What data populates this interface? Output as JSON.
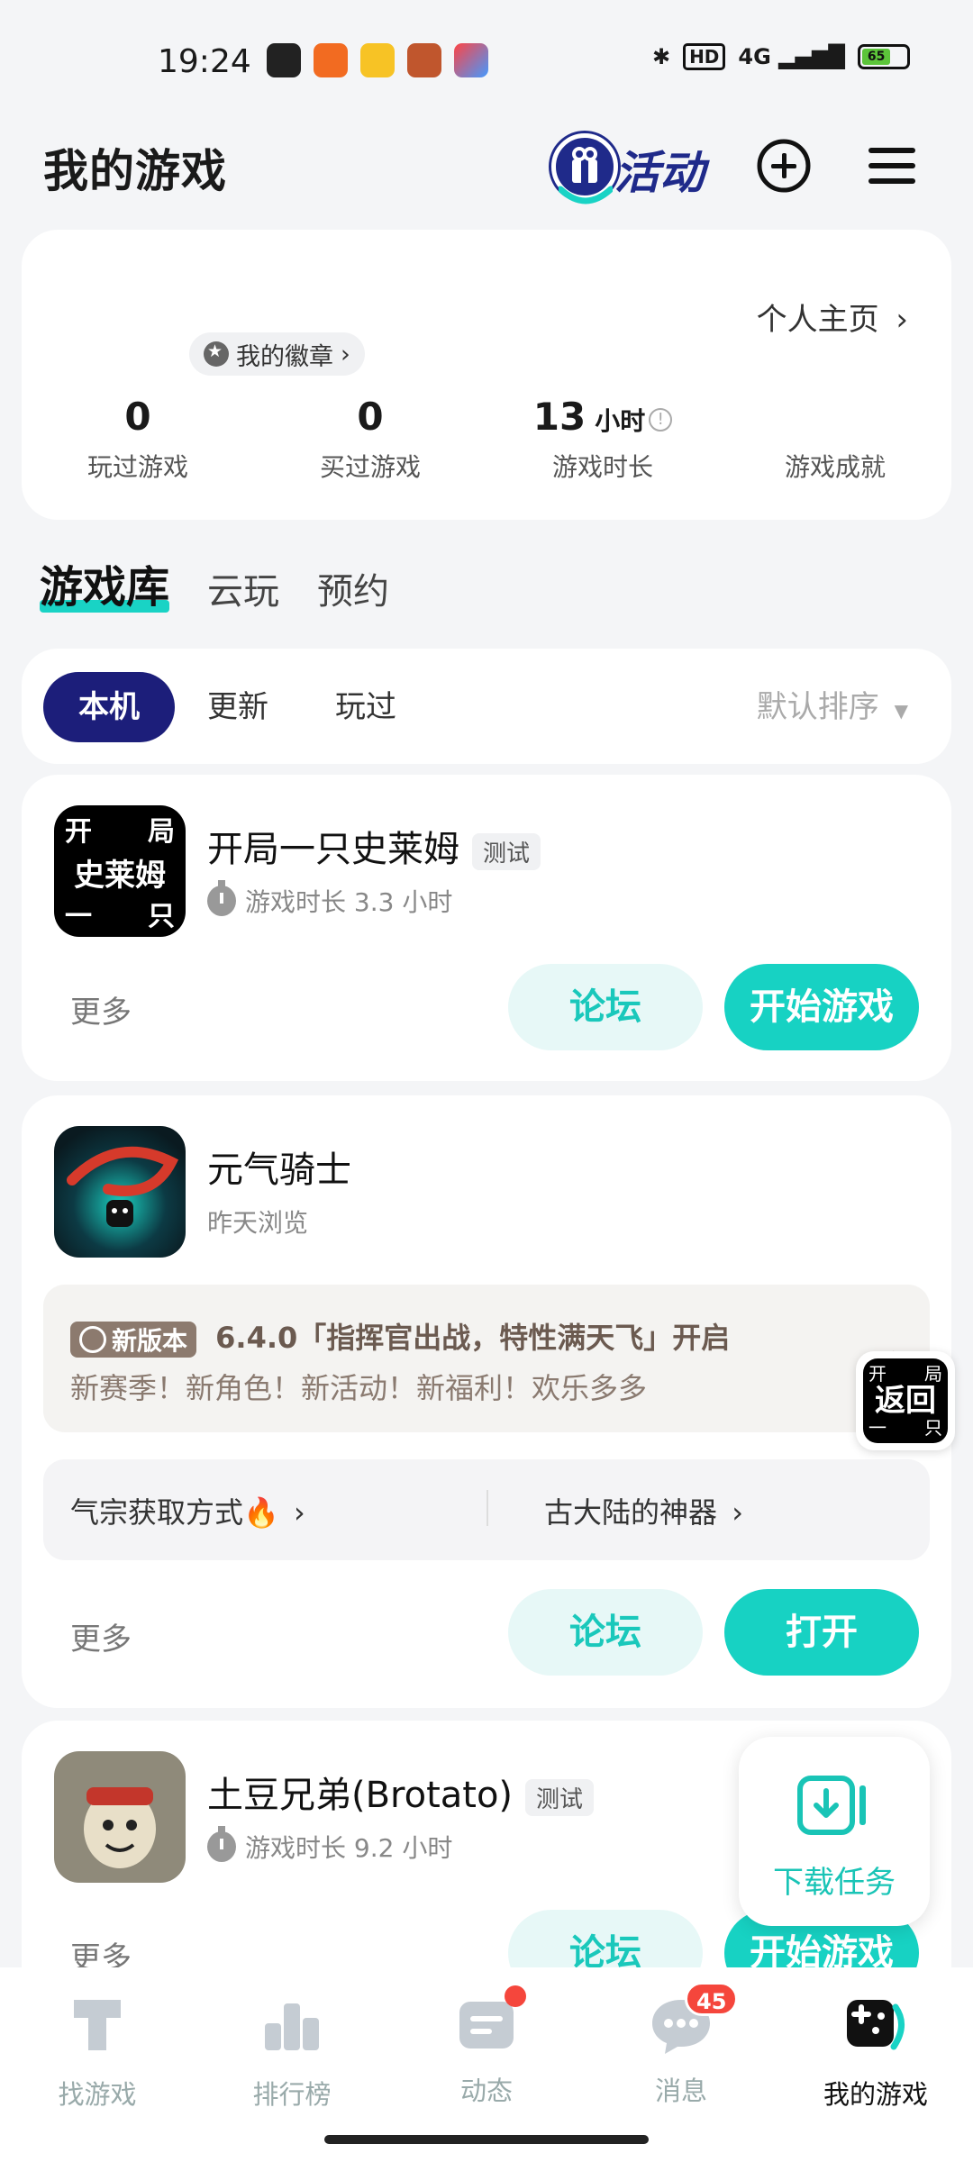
{
  "status_bar": {
    "time": "19:24",
    "hd": "HD",
    "network": "4G",
    "battery": "65"
  },
  "header": {
    "title": "我的游戏",
    "activity_label": "活动"
  },
  "profile": {
    "homepage_link": "个人主页",
    "badge_label": "我的徽章",
    "stats": [
      {
        "value": "0",
        "unit": "",
        "label": "玩过游戏"
      },
      {
        "value": "0",
        "unit": "",
        "label": "买过游戏"
      },
      {
        "value": "13",
        "unit": "小时",
        "label": "游戏时长"
      },
      {
        "value": "",
        "unit": "",
        "label": "游戏成就"
      }
    ]
  },
  "main_tabs": [
    "游戏库",
    "云玩",
    "预约"
  ],
  "filter": {
    "chips": [
      "本机",
      "更新",
      "玩过"
    ],
    "sort_label": "默认排序"
  },
  "games": [
    {
      "icon_text": [
        "开",
        "局",
        "史莱姆",
        "一",
        "只"
      ],
      "name": "开局一只史莱姆",
      "tag": "测试",
      "playtime": "游戏时长 3.3 小时",
      "more": "更多",
      "forum": "论坛",
      "action": "开始游戏"
    },
    {
      "name": "元气骑士",
      "subtitle": "昨天浏览",
      "update_tag": "新版本",
      "update_title": "6.4.0「指挥官出战，特性满天飞」开启",
      "update_desc": "新赛季！新角色！新活动！新福利！欢乐多多",
      "link_left": "气宗获取方式🔥",
      "link_right": "古大陆的神器",
      "more": "更多",
      "forum": "论坛",
      "action": "打开"
    },
    {
      "name": "土豆兄弟(Brotato)",
      "tag": "测试",
      "playtime": "游戏时长 9.2 小时",
      "more": "更多",
      "forum": "论坛",
      "action": "开始游戏"
    }
  ],
  "float_return": {
    "label": "返回",
    "corner_text": [
      "开",
      "局",
      "一",
      "只"
    ]
  },
  "download_task": {
    "label": "下载任务"
  },
  "bottom_nav": [
    {
      "label": "找游戏",
      "icon": "find-game-icon"
    },
    {
      "label": "排行榜",
      "icon": "ranking-icon"
    },
    {
      "label": "动态",
      "icon": "feed-icon"
    },
    {
      "label": "消息",
      "icon": "message-icon",
      "badge": "45"
    },
    {
      "label": "我的游戏",
      "icon": "my-games-icon"
    }
  ],
  "colors": {
    "accent": "#17d2c3",
    "navy": "#1c1e7a",
    "badge_red": "#f5463c"
  }
}
